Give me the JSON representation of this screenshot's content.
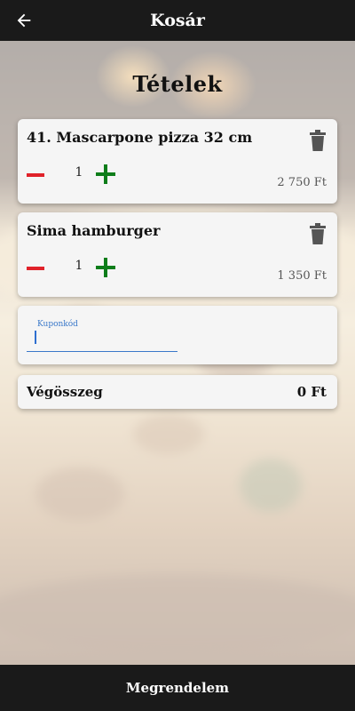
{
  "header": {
    "title": "Kosár",
    "back_icon": "arrow-left-icon"
  },
  "main": {
    "heading": "Tételek",
    "items": [
      {
        "name": "41. Mascarpone pizza 32 cm",
        "quantity": "1",
        "price": "2 750 Ft",
        "delete_icon": "trash-icon"
      },
      {
        "name": "Sima hamburger",
        "quantity": "1",
        "price": "1 350 Ft",
        "delete_icon": "trash-icon"
      }
    ],
    "coupon": {
      "label": "Kuponkód",
      "value": ""
    },
    "total": {
      "label": "Végösszeg",
      "value": "0 Ft"
    }
  },
  "footer": {
    "order_button": "Megrendelem"
  },
  "colors": {
    "bar": "#1a1a1a",
    "minus": "#e0222a",
    "plus": "#0e7d1a",
    "accent": "#3a78c9",
    "card": "#f5f5f5"
  }
}
